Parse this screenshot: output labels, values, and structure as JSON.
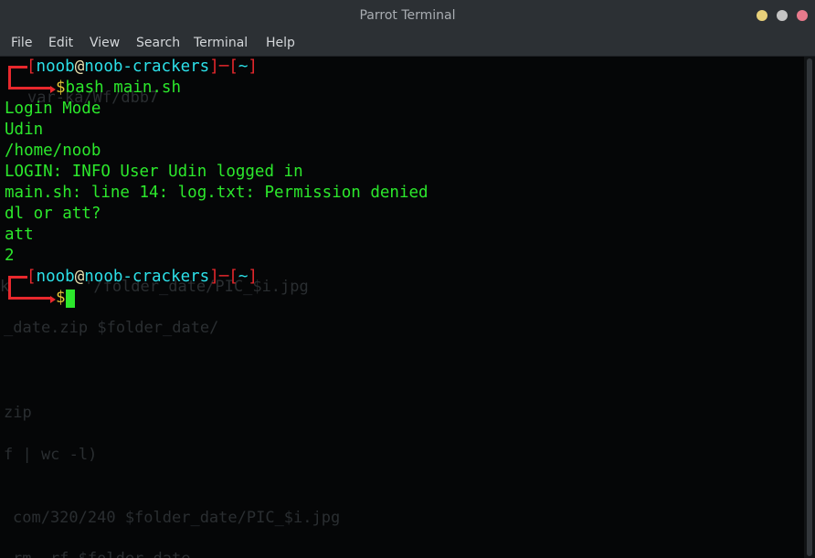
{
  "window": {
    "title": "Parrot Terminal",
    "controls": [
      {
        "name": "minimize",
        "color": "#e8d07a"
      },
      {
        "name": "maximize",
        "color": "#c4c4c4"
      },
      {
        "name": "close",
        "color": "#e87a8c"
      }
    ]
  },
  "menu": {
    "items": [
      "File",
      "Edit",
      "View",
      "Search",
      "Terminal",
      "Help"
    ]
  },
  "prompt": {
    "user": "noob",
    "at": "@",
    "host": "noob-crackers",
    "cwd": "~",
    "symbol": "$"
  },
  "session": {
    "command1": "bash main.sh",
    "output": [
      "Login Mode",
      "Udin",
      "/home/noob",
      "LOGIN: INFO User Udin logged in",
      "main.sh: line 14: log.txt: Permission denied",
      "dl or att?",
      "att",
      "2"
    ]
  },
  "colors": {
    "background": "#050607",
    "output_green": "#2ce82c",
    "prompt_red": "#e8282d",
    "prompt_cyan": "#2ce0e8",
    "dollar_yellow": "#e0c437"
  },
  "background_ghost_text": [
    "var-ka/Wf/dbb7",
    "k        '/folder_date/PIC_$i.jpg",
    "_date.zip $folder_date/",
    "zip",
    "f | wc -l)",
    "com/320/240 $folder_date/PIC_$i.jpg",
    "rm -rf $folder_date"
  ]
}
